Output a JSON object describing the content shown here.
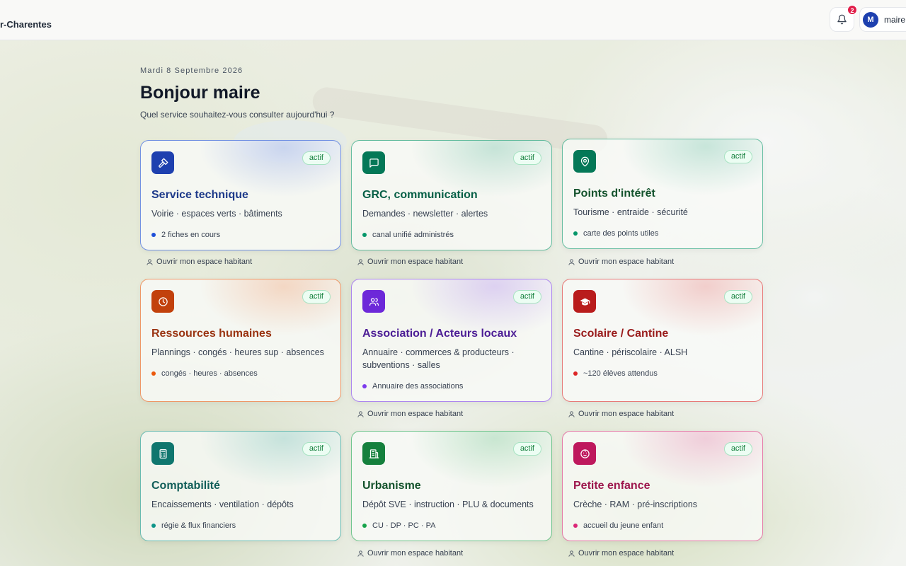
{
  "header": {
    "brand": "r-Charentes",
    "notifications_count": "2",
    "user_initial": "M",
    "user_name": "maire de"
  },
  "greeting": {
    "date": "Mardi 8 Septembre 2026",
    "title": "Bonjour maire",
    "subtitle": "Quel service souhaitez-vous consulter aujourd'hui ?"
  },
  "status_label": "actif",
  "habitant_link": "Ouvrir mon espace habitant",
  "cards": [
    {
      "title": "Service technique",
      "desc": "Voirie · espaces verts · bâtiments",
      "meta": "2 fiches en cours",
      "icon": "hammer-icon",
      "accent": "#1e3a8a",
      "icon_bg": "#1e40af",
      "dot": "#1d4ed8"
    },
    {
      "title": "GRC, communication",
      "desc": "Demandes · newsletter · alertes",
      "meta": "canal unifié administrés",
      "icon": "message-icon",
      "accent": "#065f46",
      "icon_bg": "#047857",
      "dot": "#059669"
    },
    {
      "title": "Points d'intérêt",
      "desc": "Tourisme · entraide · sécurité",
      "meta": "carte des points utiles",
      "icon": "map-pin-icon",
      "accent": "#14532d",
      "icon_bg": "#047857",
      "dot": "#059669"
    },
    {
      "title": "Ressources humaines",
      "desc": "Plannings · congés · heures sup · absences",
      "meta": "congés · heures · absences",
      "icon": "clock-icon",
      "accent": "#9a3412",
      "icon_bg": "#c2410c",
      "dot": "#ea580c"
    },
    {
      "title": "Association / Acteurs locaux",
      "desc": "Annuaire · commerces & producteurs · subventions · salles",
      "meta": "Annuaire des associations",
      "icon": "users-icon",
      "accent": "#4c1d95",
      "icon_bg": "#6d28d9",
      "dot": "#7c3aed"
    },
    {
      "title": "Scolaire / Cantine",
      "desc": "Cantine · périscolaire · ALSH",
      "meta": "~120 élèves attendus",
      "icon": "graduation-cap-icon",
      "accent": "#991b1b",
      "icon_bg": "#b91c1c",
      "dot": "#dc2626"
    },
    {
      "title": "Comptabilité",
      "desc": "Encaissements · ventilation · dépôts",
      "meta": "régie & flux financiers",
      "icon": "calculator-icon",
      "accent": "#115e59",
      "icon_bg": "#0f766e",
      "dot": "#0d9488"
    },
    {
      "title": "Urbanisme",
      "desc": "Dépôt SVE · instruction · PLU & documents",
      "meta": "CU · DP · PC · PA",
      "icon": "building-icon",
      "accent": "#14532d",
      "icon_bg": "#15803d",
      "dot": "#16a34a"
    },
    {
      "title": "Petite enfance",
      "desc": "Crèche · RAM · pré-inscriptions",
      "meta": "accueil du jeune enfant",
      "icon": "baby-icon",
      "accent": "#9d174d",
      "icon_bg": "#be185d",
      "dot": "#db2777"
    }
  ]
}
